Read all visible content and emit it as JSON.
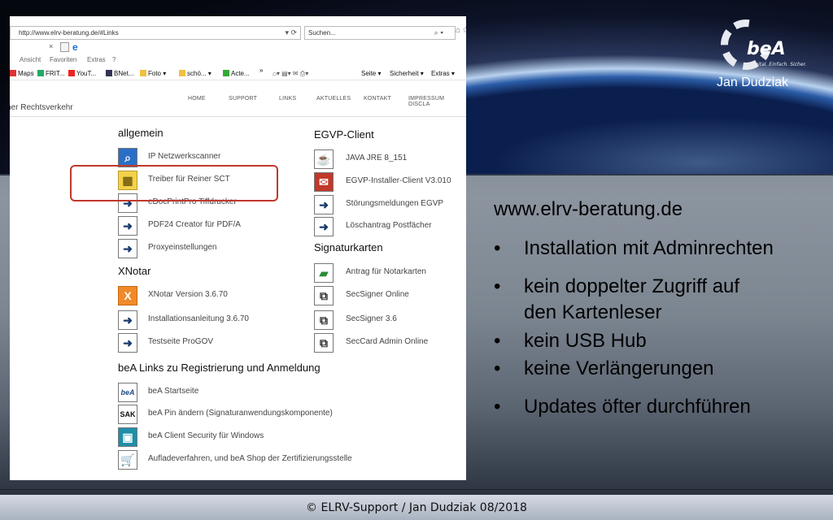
{
  "footer": "© ELRV-Support / Jan Dudziak 08/2018",
  "logo": {
    "brand": "beA",
    "tagline": "Digital. Einfach. Sicher.",
    "author": "Jan Dudziak"
  },
  "browser": {
    "url": "http://www.elrv-beratung.de/#Links",
    "search_placeholder": "Suchen...",
    "menu": [
      "Ansicht",
      "Favoriten",
      "Extras",
      "?"
    ],
    "favorites": [
      "Maps",
      "FRIT...",
      "YouT...",
      "BNet...",
      "Foto ▾",
      "schö... ▾",
      "Acte...",
      "»"
    ],
    "toolbar_right": [
      "Seite ▾",
      "Sicherheit ▾",
      "Extras ▾"
    ]
  },
  "site": {
    "name": "her Rechtsverkehr",
    "nav": [
      "HOME",
      "SUPPORT",
      "LINKS",
      "AKTUELLES",
      "KONTAKT",
      "IMPRESSUM DISCLA"
    ]
  },
  "sections": {
    "allgemein": {
      "heading": "allgemein",
      "items": [
        "IP Netzwerkscanner",
        "Treiber für Reiner SCT",
        "eDocPrintPro Tiffdrucker",
        "PDF24 Creator für PDF/A",
        "Proxyeinstellungen"
      ]
    },
    "xnotar": {
      "heading": "XNotar",
      "items": [
        "XNotar Version 3.6.70",
        "Installationsanleitung 3.6.70",
        "Testseite ProGOV"
      ]
    },
    "bea": {
      "heading": "beA Links zu Registrierung und Anmeldung",
      "items": [
        "beA Startseite",
        "beA Pin ändern  (Signaturanwendungskomponente)",
        "beA Client Security  für Windows",
        "Aufladeverfahren, und beA Shop der Zertifizierungsstelle"
      ]
    },
    "egvp": {
      "heading": "EGVP-Client",
      "items": [
        "JAVA JRE 8_151",
        "EGVP-Installer-Client V3.010",
        "Störungsmeldungen EGVP",
        "Löschantrag Postfächer"
      ]
    },
    "signatur": {
      "heading": "Signaturkarten",
      "items": [
        "Antrag für Notarkarten",
        "SecSigner Online",
        "SecSigner 3.6",
        "SecCard Admin Online"
      ]
    }
  },
  "slide": {
    "url": "www.elrv-beratung.de",
    "bullets": [
      "Installation mit Adminrechten",
      "kein doppelter Zugriff auf",
      "den Kartenleser",
      "kein USB Hub",
      "keine Verlängerungen",
      "Updates öfter durchführen"
    ],
    "bullet_char": "•"
  }
}
